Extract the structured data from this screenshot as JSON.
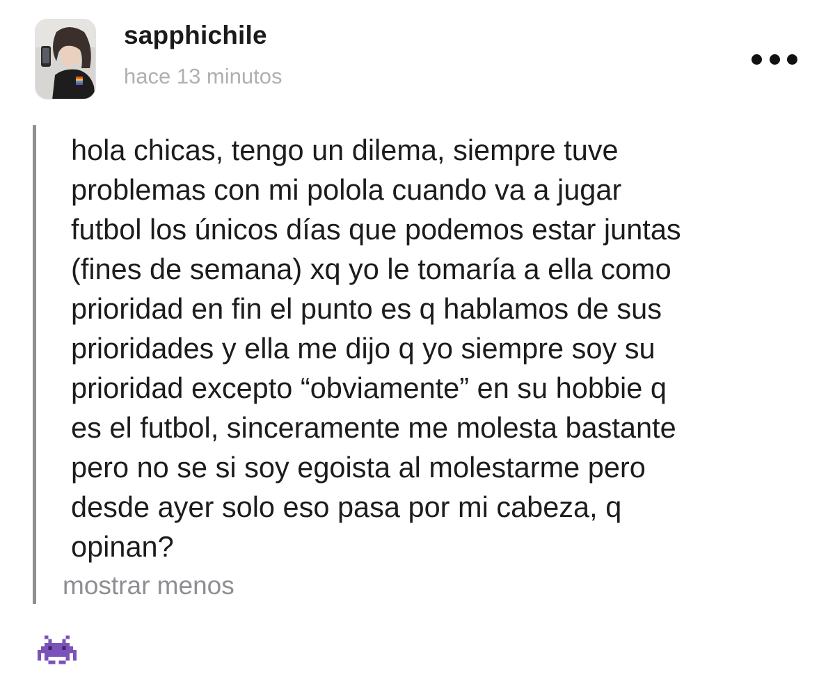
{
  "post": {
    "username": "sapphichile",
    "timestamp": "hace 13 minutos",
    "body_lines": [
      "hola chicas, tengo un dilema, siempre tuve",
      "problemas con mi polola cuando va a jugar",
      "futbol los únicos días que podemos estar juntas",
      "(fines de semana) xq yo le tomaría a ella como",
      "prioridad en fin el punto es q hablamos de sus",
      "prioridades y ella me dijo q yo siempre soy su",
      "prioridad excepto “obviamente” en su hobbie q",
      "es el futbol, sinceramente me molesta bastante",
      "pero no se si soy egoista al molestarme pero",
      "desde ayer solo eso pasa por mi cabeza, q",
      "opinan?"
    ],
    "show_less_label": "mostrar menos"
  },
  "icons": {
    "more_options": "more-horizontal-icon",
    "reaction": "space-invader-icon"
  },
  "colors": {
    "text": "#1c1c1e",
    "muted": "#8e8e93",
    "timestamp": "#b0b0b4",
    "reaction": "#7b52b9"
  }
}
